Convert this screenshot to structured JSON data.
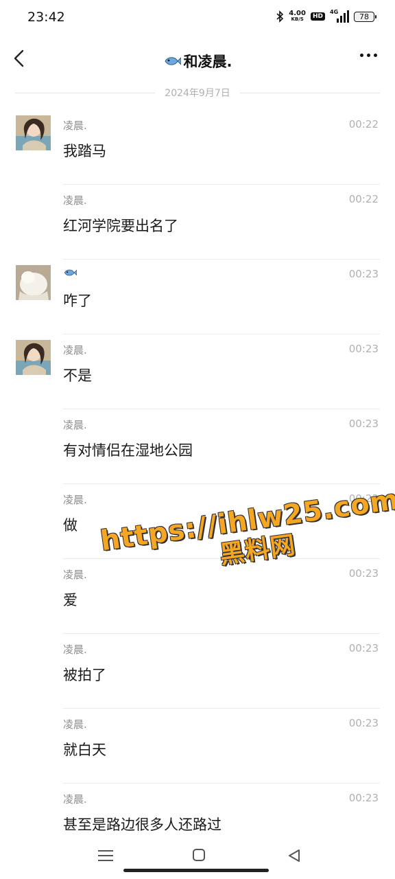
{
  "status_bar": {
    "time": "23:42",
    "net_speed_value": "4.00",
    "net_speed_unit": "KB/S",
    "hd_label": "HD",
    "signal_label": "4G",
    "battery": "78"
  },
  "header": {
    "back_icon": "chevron-left-icon",
    "title_emoji_icon": "fish-icon",
    "title": "和凌晨.",
    "more_icon": "more-dots-icon"
  },
  "date_divider": "2024年9月7日",
  "messages": [
    {
      "sender": "凌晨.",
      "time": "00:22",
      "text": "我踏马",
      "avatar": "anime-girl-avatar"
    },
    {
      "sender": "凌晨.",
      "time": "00:22",
      "text": "红河学院要出名了"
    },
    {
      "sender": "",
      "sender_icon": "fish-icon",
      "time": "00:23",
      "text": "咋了",
      "avatar": "white-cat-avatar"
    },
    {
      "sender": "凌晨.",
      "time": "00:23",
      "text": "不是",
      "avatar": "anime-girl-avatar"
    },
    {
      "sender": "凌晨.",
      "time": "00:23",
      "text": "有对情侣在湿地公园"
    },
    {
      "sender": "凌晨.",
      "time": "00:23",
      "text": "做"
    },
    {
      "sender": "凌晨.",
      "time": "00:23",
      "text": "爱"
    },
    {
      "sender": "凌晨.",
      "time": "00:23",
      "text": "被拍了"
    },
    {
      "sender": "凌晨.",
      "time": "00:23",
      "text": "就白天"
    },
    {
      "sender": "凌晨.",
      "time": "00:23",
      "text": "甚至是路边很多人还路过"
    }
  ],
  "watermark": {
    "url": "https://ihlw25.com",
    "name": "黑料网"
  },
  "nav_bar": {
    "menu_icon": "menu-icon",
    "home_icon": "home-icon",
    "back_icon": "back-triangle-icon"
  }
}
